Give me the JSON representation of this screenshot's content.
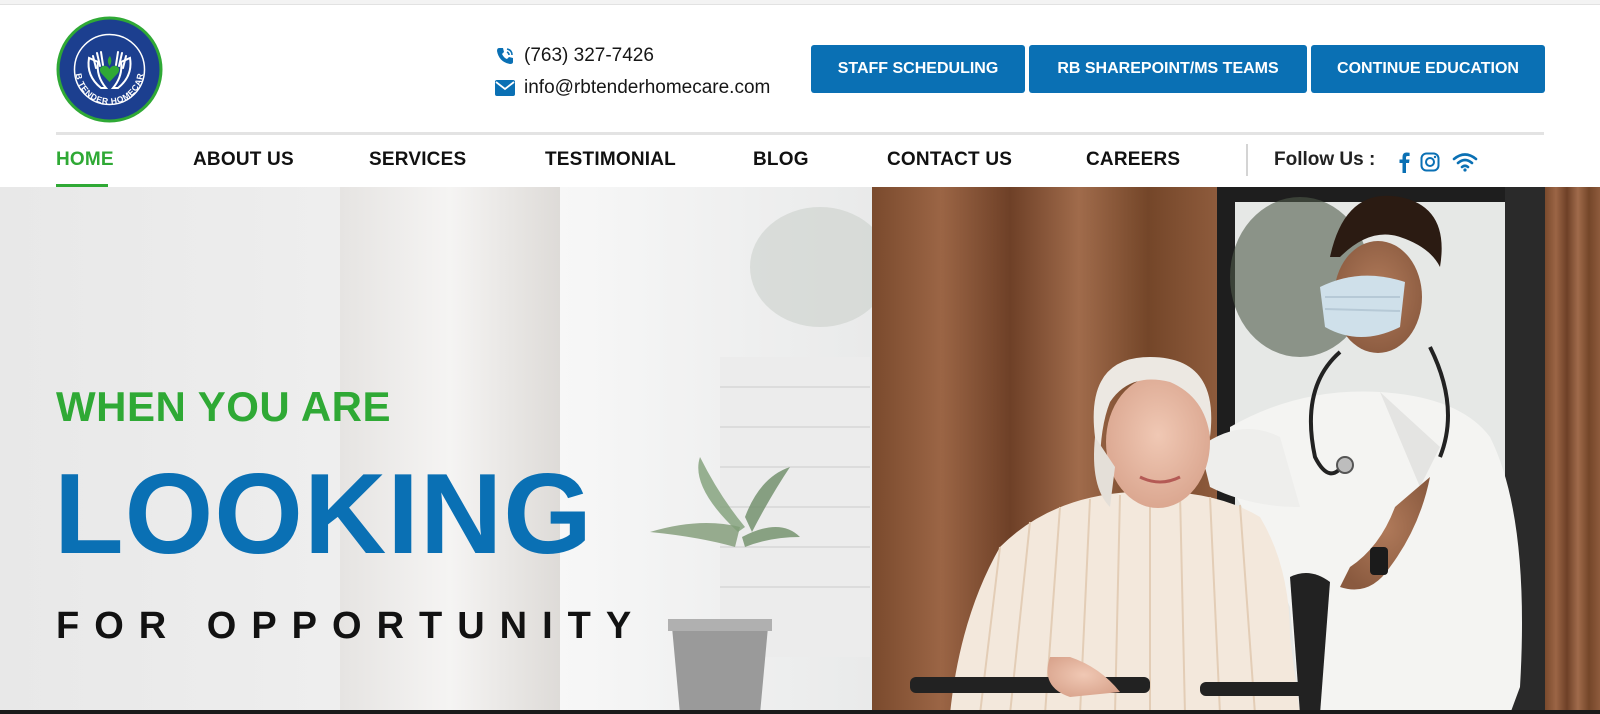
{
  "brand": {
    "logo_text": "RB TENDER HOMECARE"
  },
  "contact": {
    "phone": "(763) 327-7426",
    "email": "info@rbtenderhomecare.com"
  },
  "header_buttons": {
    "staff_scheduling": "STAFF SCHEDULING",
    "sharepoint": "RB SHAREPOINT/MS TEAMS",
    "continue_education": "CONTINUE EDUCATION"
  },
  "nav": {
    "items": [
      {
        "label": "HOME",
        "active": true
      },
      {
        "label": "ABOUT US",
        "active": false
      },
      {
        "label": "SERVICES",
        "active": false
      },
      {
        "label": "TESTIMONIAL",
        "active": false
      },
      {
        "label": "BLOG",
        "active": false
      },
      {
        "label": "CONTACT US",
        "active": false
      },
      {
        "label": "CAREERS",
        "active": false
      }
    ],
    "follow_label": "Follow Us :",
    "social_icons": [
      "facebook-icon",
      "instagram-icon",
      "wifi-icon"
    ]
  },
  "hero": {
    "kicker": "WHEN YOU ARE",
    "headline": "LOOKING",
    "subheadline": "FOR OPPORTUNITY"
  },
  "colors": {
    "brand_blue": "#0a70b4",
    "brand_green": "#2fa935",
    "logo_navy": "#1c3f8f"
  }
}
